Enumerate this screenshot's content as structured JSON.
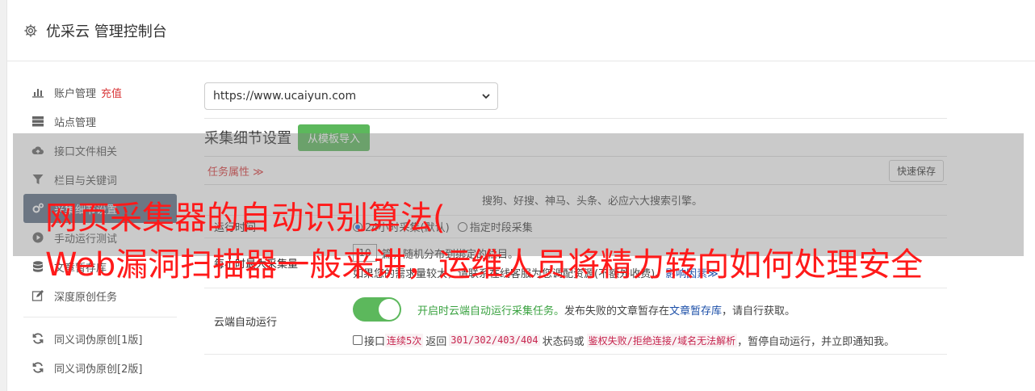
{
  "header": {
    "title": "优采云 管理控制台"
  },
  "sidebar": {
    "items": [
      {
        "label": "账户管理",
        "badge": "充值",
        "icon": "bar-chart-icon"
      },
      {
        "label": "站点管理",
        "icon": "server-icon"
      },
      {
        "label": "接口文件相关",
        "icon": "cloud-upload-icon"
      },
      {
        "label": "栏目与关键词",
        "icon": "filter-icon"
      },
      {
        "label": "采集细节设置",
        "icon": "gears-icon"
      },
      {
        "label": "手动运行测试",
        "icon": "play-circle-icon"
      },
      {
        "label": "文章暂存库",
        "icon": "database-icon"
      },
      {
        "label": "深度原创任务",
        "icon": "edit-icon"
      },
      {
        "label": "同义词伪原创[1版]",
        "icon": "refresh-icon"
      },
      {
        "label": "同义词伪原创[2版]",
        "icon": "refresh-icon"
      }
    ]
  },
  "main": {
    "site_select": "https://www.ucaiyun.com",
    "section_title": "采集细节设置",
    "import_button": "从模板导入",
    "task_attr": "任务属性 ≫",
    "quick_save": "快速保存",
    "engines_line": "搜狗、好搜、神马、头条、必应六大搜索引擎。",
    "run_time_label": "运行时间",
    "run_opt1": "24小时采集(默认)",
    "run_opt2": "指定时段采集",
    "max_label": "每小时最大采集量",
    "max_value": "10",
    "max_desc": "篇，随机分布到绑定的栏目。",
    "max_tip": "如果您的需求量较大，请联系在线客服为您调配资源(不额外收费)。",
    "max_link": "影响因素≫",
    "cloud_label": "云端自动运行",
    "cloud_text1": "开启时云端自动运行采集任务。",
    "cloud_text2": "发布失败的文章暂存在",
    "cloud_link": "文章暂存库",
    "cloud_text3": "，请自行获取。",
    "api_cb": "接口",
    "api_fail": "连续5次",
    "api_return": "返回",
    "api_codes": "301/302/403/404",
    "api_or": "状态码或",
    "api_errors": "鉴权失败/拒绝连接/域名无法解析",
    "api_end": "，暂停自动运行，并立即通知我。"
  },
  "overlay": {
    "line1": "网页采集器的自动识别算法(",
    "line2": "Web漏洞扫描器一般来讲，运维人员将精力转向如何处理安全"
  }
}
